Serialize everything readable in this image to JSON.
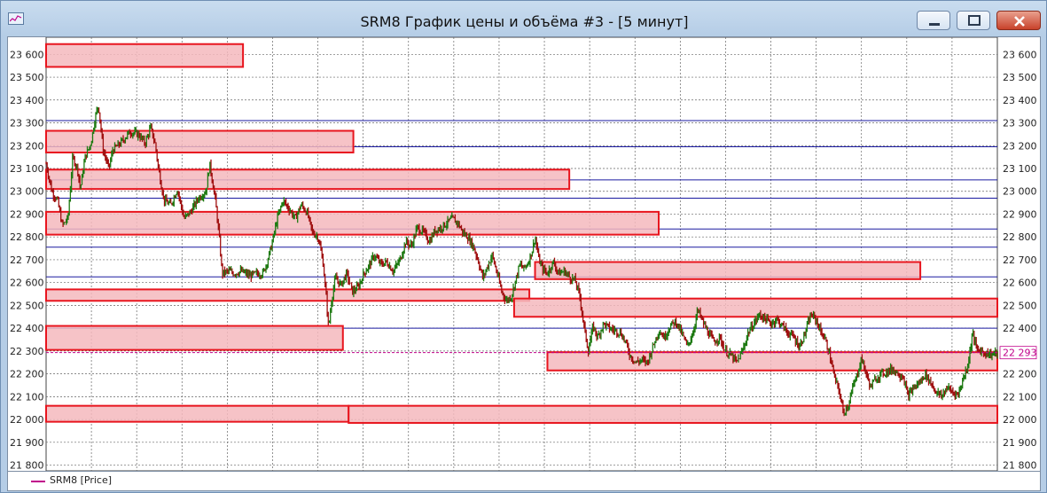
{
  "window": {
    "title": "SRM8 График цены и объёма #3 - [5 минут]",
    "icon": "chart-icon",
    "buttons": [
      "minimize-icon",
      "maximize-icon",
      "close-icon"
    ]
  },
  "legend": {
    "label": "SRM8 [Price]",
    "color": "#c0008a"
  },
  "colors": {
    "up": "#1e7a12",
    "down": "#a01010",
    "zone_fill": "#f5b9bd",
    "zone_stroke": "#e8151e",
    "hline": "#1a1aa0",
    "current": "#c0008a"
  },
  "chart_data": {
    "type": "line",
    "ylim": [
      21775,
      23675
    ],
    "yticks": [
      21800,
      21900,
      22000,
      22100,
      22200,
      22300,
      22400,
      22500,
      22600,
      22700,
      22800,
      22900,
      23000,
      23100,
      23200,
      23300,
      23400,
      23500,
      23600
    ],
    "ytick_labels": [
      "21 800",
      "21 900",
      "22 000",
      "22 100",
      "22 200",
      "22 300",
      "22 400",
      "22 500",
      "22 600",
      "22 700",
      "22 800",
      "22 900",
      "23 000",
      "23 100",
      "23 200",
      "23 300",
      "23 400",
      "23 500",
      "23 600"
    ],
    "current_price": 22293,
    "current_label": "22 293",
    "horizontal_levels": [
      23310,
      23195,
      23050,
      22970,
      22835,
      22755,
      22625,
      22400
    ],
    "zones": [
      {
        "start": 0.0,
        "end": 0.207,
        "low": 23545,
        "high": 23645
      },
      {
        "start": 0.0,
        "end": 0.323,
        "low": 23170,
        "high": 23265
      },
      {
        "start": 0.0,
        "end": 0.55,
        "low": 23010,
        "high": 23095
      },
      {
        "start": 0.0,
        "end": 0.644,
        "low": 22810,
        "high": 22910
      },
      {
        "start": 0.0,
        "end": 0.508,
        "low": 22520,
        "high": 22570
      },
      {
        "start": 0.0,
        "end": 0.312,
        "low": 22305,
        "high": 22410
      },
      {
        "start": 0.0,
        "end": 0.318,
        "low": 21990,
        "high": 22060
      },
      {
        "start": 0.318,
        "end": 1.0,
        "low": 21985,
        "high": 22060
      },
      {
        "start": 0.492,
        "end": 1.0,
        "low": 22450,
        "high": 22530
      },
      {
        "start": 0.514,
        "end": 0.919,
        "low": 22615,
        "high": 22690
      },
      {
        "start": 0.527,
        "end": 1.0,
        "low": 22215,
        "high": 22295
      }
    ],
    "price_path": [
      [
        0.0,
        23120
      ],
      [
        0.006,
        23000
      ],
      [
        0.012,
        22960
      ],
      [
        0.017,
        22850
      ],
      [
        0.023,
        22880
      ],
      [
        0.028,
        23150
      ],
      [
        0.033,
        23100
      ],
      [
        0.036,
        23010
      ],
      [
        0.041,
        23150
      ],
      [
        0.047,
        23210
      ],
      [
        0.052,
        23330
      ],
      [
        0.055,
        23380
      ],
      [
        0.06,
        23180
      ],
      [
        0.066,
        23100
      ],
      [
        0.07,
        23180
      ],
      [
        0.078,
        23210
      ],
      [
        0.088,
        23260
      ],
      [
        0.097,
        23250
      ],
      [
        0.104,
        23210
      ],
      [
        0.11,
        23280
      ],
      [
        0.115,
        23200
      ],
      [
        0.118,
        23100
      ],
      [
        0.124,
        22960
      ],
      [
        0.131,
        22940
      ],
      [
        0.138,
        23010
      ],
      [
        0.145,
        22880
      ],
      [
        0.152,
        22910
      ],
      [
        0.16,
        22970
      ],
      [
        0.168,
        23000
      ],
      [
        0.172,
        23120
      ],
      [
        0.178,
        22960
      ],
      [
        0.182,
        22800
      ],
      [
        0.185,
        22640
      ],
      [
        0.192,
        22650
      ],
      [
        0.198,
        22640
      ],
      [
        0.205,
        22650
      ],
      [
        0.214,
        22630
      ],
      [
        0.222,
        22640
      ],
      [
        0.228,
        22640
      ],
      [
        0.233,
        22700
      ],
      [
        0.238,
        22780
      ],
      [
        0.243,
        22880
      ],
      [
        0.249,
        22960
      ],
      [
        0.256,
        22920
      ],
      [
        0.262,
        22880
      ],
      [
        0.268,
        22940
      ],
      [
        0.274,
        22910
      ],
      [
        0.28,
        22820
      ],
      [
        0.286,
        22800
      ],
      [
        0.291,
        22690
      ],
      [
        0.294,
        22560
      ],
      [
        0.297,
        22400
      ],
      [
        0.3,
        22520
      ],
      [
        0.304,
        22620
      ],
      [
        0.31,
        22590
      ],
      [
        0.316,
        22640
      ],
      [
        0.322,
        22560
      ],
      [
        0.328,
        22580
      ],
      [
        0.334,
        22640
      ],
      [
        0.339,
        22670
      ],
      [
        0.345,
        22720
      ],
      [
        0.352,
        22680
      ],
      [
        0.358,
        22690
      ],
      [
        0.365,
        22650
      ],
      [
        0.372,
        22700
      ],
      [
        0.378,
        22780
      ],
      [
        0.384,
        22760
      ],
      [
        0.39,
        22840
      ],
      [
        0.397,
        22820
      ],
      [
        0.403,
        22780
      ],
      [
        0.409,
        22830
      ],
      [
        0.415,
        22840
      ],
      [
        0.421,
        22860
      ],
      [
        0.427,
        22880
      ],
      [
        0.433,
        22860
      ],
      [
        0.438,
        22820
      ],
      [
        0.443,
        22800
      ],
      [
        0.449,
        22760
      ],
      [
        0.454,
        22700
      ],
      [
        0.459,
        22620
      ],
      [
        0.464,
        22670
      ],
      [
        0.469,
        22720
      ],
      [
        0.474,
        22640
      ],
      [
        0.479,
        22560
      ],
      [
        0.484,
        22520
      ],
      [
        0.489,
        22540
      ],
      [
        0.493,
        22600
      ],
      [
        0.498,
        22680
      ],
      [
        0.502,
        22660
      ],
      [
        0.507,
        22690
      ],
      [
        0.511,
        22740
      ],
      [
        0.514,
        22800
      ],
      [
        0.518,
        22700
      ],
      [
        0.522,
        22660
      ],
      [
        0.527,
        22640
      ],
      [
        0.533,
        22690
      ],
      [
        0.539,
        22640
      ],
      [
        0.545,
        22650
      ],
      [
        0.551,
        22620
      ],
      [
        0.556,
        22610
      ],
      [
        0.561,
        22540
      ],
      [
        0.565,
        22420
      ],
      [
        0.57,
        22300
      ],
      [
        0.575,
        22410
      ],
      [
        0.58,
        22360
      ],
      [
        0.586,
        22420
      ],
      [
        0.592,
        22400
      ],
      [
        0.598,
        22390
      ],
      [
        0.604,
        22380
      ],
      [
        0.609,
        22340
      ],
      [
        0.614,
        22280
      ],
      [
        0.62,
        22250
      ],
      [
        0.626,
        22260
      ],
      [
        0.632,
        22250
      ],
      [
        0.638,
        22320
      ],
      [
        0.644,
        22390
      ],
      [
        0.65,
        22360
      ],
      [
        0.656,
        22410
      ],
      [
        0.662,
        22430
      ],
      [
        0.668,
        22380
      ],
      [
        0.674,
        22320
      ],
      [
        0.68,
        22380
      ],
      [
        0.685,
        22480
      ],
      [
        0.69,
        22430
      ],
      [
        0.696,
        22380
      ],
      [
        0.702,
        22340
      ],
      [
        0.708,
        22360
      ],
      [
        0.714,
        22300
      ],
      [
        0.72,
        22280
      ],
      [
        0.726,
        22250
      ],
      [
        0.732,
        22300
      ],
      [
        0.738,
        22380
      ],
      [
        0.744,
        22420
      ],
      [
        0.75,
        22460
      ],
      [
        0.756,
        22440
      ],
      [
        0.762,
        22420
      ],
      [
        0.768,
        22440
      ],
      [
        0.774,
        22410
      ],
      [
        0.78,
        22380
      ],
      [
        0.786,
        22360
      ],
      [
        0.792,
        22320
      ],
      [
        0.798,
        22380
      ],
      [
        0.804,
        22460
      ],
      [
        0.809,
        22440
      ],
      [
        0.814,
        22390
      ],
      [
        0.819,
        22350
      ],
      [
        0.824,
        22280
      ],
      [
        0.829,
        22180
      ],
      [
        0.834,
        22120
      ],
      [
        0.838,
        22030
      ],
      [
        0.843,
        22060
      ],
      [
        0.848,
        22140
      ],
      [
        0.853,
        22200
      ],
      [
        0.857,
        22270
      ],
      [
        0.862,
        22200
      ],
      [
        0.867,
        22140
      ],
      [
        0.872,
        22180
      ],
      [
        0.878,
        22200
      ],
      [
        0.884,
        22210
      ],
      [
        0.89,
        22220
      ],
      [
        0.896,
        22200
      ],
      [
        0.901,
        22190
      ],
      [
        0.906,
        22100
      ],
      [
        0.912,
        22140
      ],
      [
        0.918,
        22160
      ],
      [
        0.924,
        22200
      ],
      [
        0.93,
        22160
      ],
      [
        0.936,
        22120
      ],
      [
        0.941,
        22100
      ],
      [
        0.947,
        22140
      ],
      [
        0.953,
        22120
      ],
      [
        0.959,
        22110
      ],
      [
        0.964,
        22180
      ],
      [
        0.969,
        22240
      ],
      [
        0.974,
        22380
      ],
      [
        0.978,
        22310
      ],
      [
        0.983,
        22300
      ],
      [
        0.988,
        22290
      ],
      [
        0.994,
        22285
      ],
      [
        1.0,
        22293
      ]
    ]
  }
}
